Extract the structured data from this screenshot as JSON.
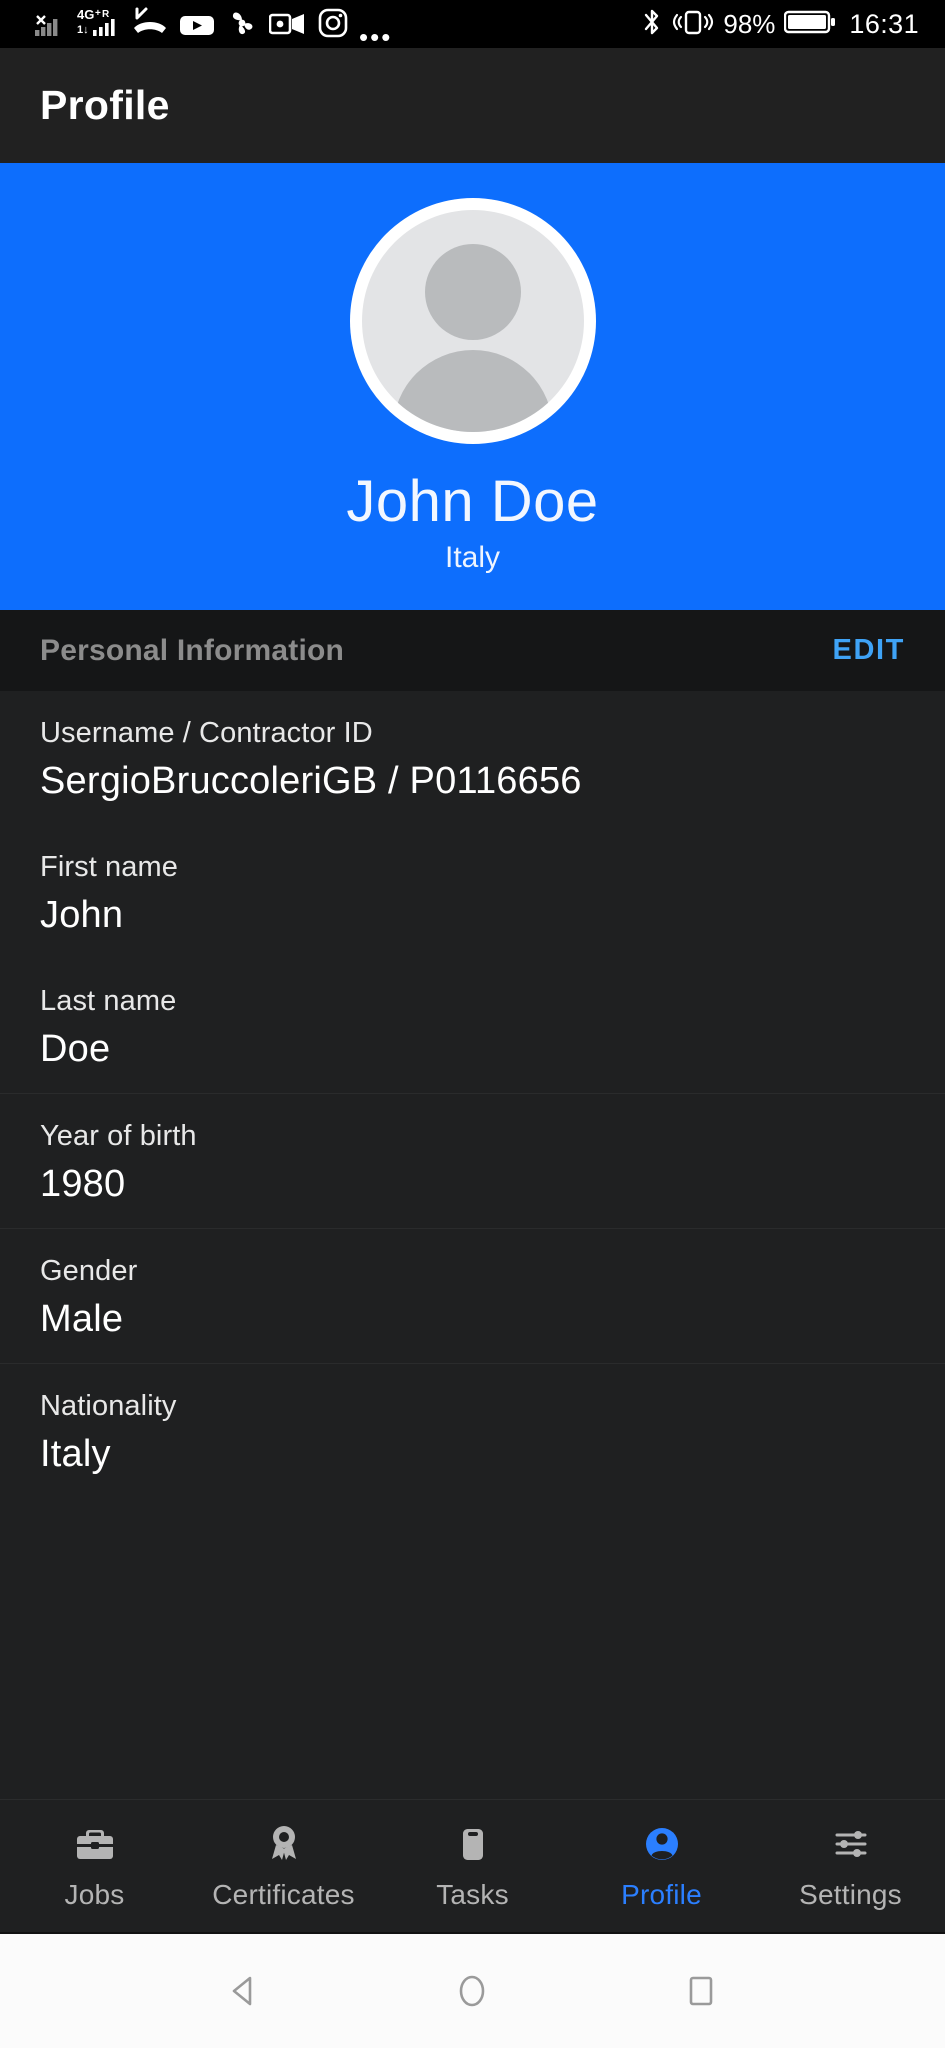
{
  "status_bar": {
    "left_icons": [
      "signal-x-icon",
      "4g-plus-r-signal-icon",
      "missed-call-icon",
      "youtube-icon",
      "fan-icon",
      "outlook-icon",
      "instagram-icon"
    ],
    "network_label": "4G+R",
    "overflow": "•••",
    "bluetooth_icon": "bluetooth-icon",
    "vibrate_icon": "vibrate-icon",
    "battery_percent": "98%",
    "battery_icon": "battery-icon",
    "clock": "16:31"
  },
  "app_bar": {
    "title": "Profile"
  },
  "hero": {
    "avatar_icon": "default-avatar-icon",
    "name": "John Doe",
    "subtitle": "Italy",
    "background_color": "#0D6EFD"
  },
  "section": {
    "title": "Personal Information",
    "action_label": "EDIT",
    "action_color": "#3FA3F6"
  },
  "fields": [
    {
      "label": "Username / Contractor ID",
      "value": "SergioBruccoleriGB / P0116656"
    },
    {
      "label": "First name",
      "value": "John"
    },
    {
      "label": "Last name",
      "value": "Doe"
    },
    {
      "label": "Year of birth",
      "value": "1980"
    },
    {
      "label": "Gender",
      "value": "Male"
    },
    {
      "label": "Nationality",
      "value": "Italy"
    }
  ],
  "tabbar": {
    "active_color": "#2B7FFF",
    "inactive_color": "#b4b4b4",
    "items": [
      {
        "label": "Jobs",
        "icon": "briefcase-icon",
        "active": false
      },
      {
        "label": "Certificates",
        "icon": "award-ribbon-icon",
        "active": false
      },
      {
        "label": "Tasks",
        "icon": "clipboard-icon",
        "active": false
      },
      {
        "label": "Profile",
        "icon": "person-circle-icon",
        "active": true
      },
      {
        "label": "Settings",
        "icon": "sliders-icon",
        "active": false
      }
    ]
  },
  "android_nav": {
    "back": "back-triangle-icon",
    "home": "home-circle-icon",
    "recents": "recents-square-icon"
  }
}
